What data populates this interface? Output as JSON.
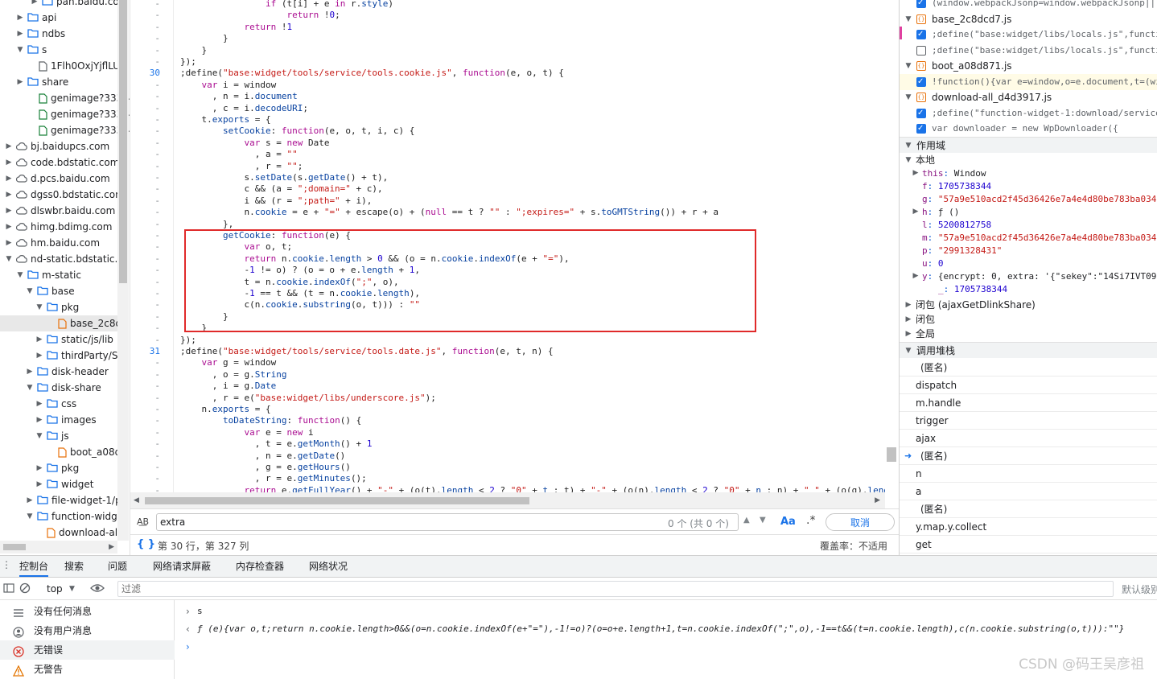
{
  "tree": {
    "rows": [
      {
        "label": "pan.baidu.com",
        "icon": "folder-icon"
      },
      {
        "label": "api",
        "icon": "folder-icon"
      },
      {
        "label": "ndbs",
        "icon": "folder-icon"
      },
      {
        "label": "s",
        "icon": "folder-icon"
      },
      {
        "label": "1Flh0OxjYjflLUY",
        "icon": "file-icon"
      },
      {
        "label": "share",
        "icon": "folder-icon"
      },
      {
        "label": "genimage?333242",
        "icon": "file-icon"
      },
      {
        "label": "genimage?333242",
        "icon": "file-icon"
      },
      {
        "label": "genimage?333242",
        "icon": "file-icon"
      },
      {
        "label": "bj.baidupcs.com",
        "icon": "cloud-icon"
      },
      {
        "label": "code.bdstatic.com",
        "icon": "cloud-icon"
      },
      {
        "label": "d.pcs.baidu.com",
        "icon": "cloud-icon"
      },
      {
        "label": "dgss0.bdstatic.com",
        "icon": "cloud-icon"
      },
      {
        "label": "dlswbr.baidu.com",
        "icon": "cloud-icon"
      },
      {
        "label": "himg.bdimg.com",
        "icon": "cloud-icon"
      },
      {
        "label": "hm.baidu.com",
        "icon": "cloud-icon"
      },
      {
        "label": "nd-static.bdstatic.co",
        "icon": "cloud-icon"
      },
      {
        "label": "m-static",
        "icon": "folder-icon"
      },
      {
        "label": "base",
        "icon": "folder-icon"
      },
      {
        "label": "pkg",
        "icon": "folder-icon"
      },
      {
        "label": "base_2c8dc",
        "icon": "file-icon"
      },
      {
        "label": "static/js/lib",
        "icon": "folder-icon"
      },
      {
        "label": "thirdParty/Sy",
        "icon": "folder-icon"
      },
      {
        "label": "disk-header",
        "icon": "folder-icon"
      },
      {
        "label": "disk-share",
        "icon": "folder-icon"
      },
      {
        "label": "css",
        "icon": "folder-icon"
      },
      {
        "label": "images",
        "icon": "folder-icon"
      },
      {
        "label": "js",
        "icon": "folder-icon"
      },
      {
        "label": "boot_a08d",
        "icon": "file-icon"
      },
      {
        "label": "pkg",
        "icon": "folder-icon"
      },
      {
        "label": "widget",
        "icon": "folder-icon"
      },
      {
        "label": "file-widget-1/p",
        "icon": "folder-icon"
      },
      {
        "label": "function-widge",
        "icon": "folder-icon"
      },
      {
        "label": "download-all",
        "icon": "file-icon"
      }
    ]
  },
  "editor": {
    "line_numbers": [
      "-",
      "-",
      "-",
      "-",
      "-",
      "-",
      "30",
      "-",
      "-",
      "-",
      "-",
      "-",
      "-",
      "-",
      "-",
      "-",
      "-",
      "-",
      "-",
      "-",
      "-",
      "-",
      "-",
      "-",
      "-",
      "-",
      "-",
      "-",
      "-",
      "-",
      "31",
      "-",
      "-",
      "-",
      "-",
      "-",
      "-",
      "-",
      "-",
      "-",
      "-",
      "-",
      "-"
    ],
    "lines": [
      "                if (t[i] + e in r.style)",
      "                    return !0;",
      "            return !1",
      "        }",
      "    }",
      "});",
      ";define(\"base:widget/tools/service/tools.cookie.js\", function(e, o, t) {",
      "    var i = window",
      "      , n = i.document",
      "      , c = i.decodeURI;",
      "    t.exports = {",
      "        setCookie: function(e, o, t, i, c) {",
      "            var s = new Date",
      "              , a = \"\"",
      "              , r = \"\";",
      "            s.setDate(s.getDate() + t),",
      "            c && (a = \";domain=\" + c),",
      "            i && (r = \";path=\" + i),",
      "            n.cookie = e + \"=\" + escape(o) + (null == t ? \"\" : \";expires=\" + s.toGMTString()) + r + a",
      "        },",
      "        getCookie: function(e) {",
      "            var o, t;",
      "            return n.cookie.length > 0 && (o = n.cookie.indexOf(e + \"=\"),",
      "            -1 != o) ? (o = o + e.length + 1,",
      "            t = n.cookie.indexOf(\";\", o),",
      "            -1 == t && (t = n.cookie.length),",
      "            c(n.cookie.substring(o, t))) : \"\"",
      "        }",
      "    }",
      "});",
      ";define(\"base:widget/tools/service/tools.date.js\", function(e, t, n) {",
      "    var g = window",
      "      , o = g.String",
      "      , i = g.Date",
      "      , r = e(\"base:widget/libs/underscore.js\");",
      "    n.exports = {",
      "        toDateString: function() {",
      "            var e = new i",
      "              , t = e.getMonth() + 1",
      "              , n = e.getDate()",
      "              , g = e.getHours()",
      "              , r = e.getMinutes();",
      "            return e.getFullYear() + \"-\" + (o(t).length < 2 ? \"0\" + t : t) + \"-\" + (o(n).length < 2 ? \"0\" + n : n) + \" \" + (o(g).leng"
    ]
  },
  "search": {
    "case_icon": "A͟B",
    "value": "extra",
    "count": "0 个 (共 0 个)",
    "prev": "▲",
    "next": "▼",
    "match_case": "Aa",
    "regex": ".*",
    "cancel": "取消"
  },
  "status": {
    "braces": "{ }",
    "position": "第 30 行，第 327 列",
    "coverage": "覆盖率：不适用"
  },
  "breakpoints": {
    "top_line": "(window.webpackJsonp=window.webpackJsonp||[",
    "groups": [
      {
        "file": "base_2c8dcd7.js",
        "items": [
          {
            "code": ";define(\"base:widget/libs/locals.js\",functi",
            "checked": true
          },
          {
            "code": ";define(\"base:widget/libs/locals.js\",functi",
            "checked": false
          }
        ]
      },
      {
        "file": "boot_a08d871.js",
        "items": [
          {
            "code": "!function(){var e=window,o=e.document,t=(wi",
            "checked": true
          }
        ]
      },
      {
        "file": "download-all_d4d3917.js",
        "items": [
          {
            "code": ";define(\"function-widget-1:download/service",
            "checked": true
          },
          {
            "code": "var downloader = new WpDownloader({",
            "checked": true
          }
        ]
      }
    ]
  },
  "scope": {
    "title": "作用域",
    "local_title": "本地",
    "vars": [
      {
        "name": "this",
        "value": "Window",
        "kind": "obj",
        "expand": true
      },
      {
        "name": "f",
        "value": "1705738344",
        "kind": "num",
        "expand": false
      },
      {
        "name": "g",
        "value": "\"57a9e510acd2f45d36426e7a4e4d80be783ba034",
        "kind": "str",
        "expand": false
      },
      {
        "name": "h",
        "value": "ƒ ()",
        "kind": "obj",
        "expand": true
      },
      {
        "name": "l",
        "value": "5200812758",
        "kind": "num",
        "expand": false
      },
      {
        "name": "m",
        "value": "\"57a9e510acd2f45d36426e7a4e4d80be783ba034",
        "kind": "str",
        "expand": false
      },
      {
        "name": "p",
        "value": "\"2991328431\"",
        "kind": "str",
        "expand": false
      },
      {
        "name": "u",
        "value": "0",
        "kind": "num",
        "expand": false
      },
      {
        "name": "y",
        "value": "{encrypt: 0, extra: '{\"sekey\":\"14Si7IVT09",
        "kind": "obj",
        "expand": true
      },
      {
        "name": "_",
        "value": "1705738344",
        "kind": "num",
        "expand": false
      }
    ],
    "closures": [
      "闭包 (ajaxGetDlinkShare)",
      "闭包",
      "全局"
    ]
  },
  "callstack": {
    "title": "调用堆栈",
    "frames": [
      "(匿名)",
      "dispatch",
      "m.handle",
      "trigger",
      "ajax",
      "(匿名)",
      "n",
      "a",
      "(匿名)",
      "y.map.y.collect",
      "get"
    ]
  },
  "drawer": {
    "menu_icon": "⋮",
    "tabs": [
      "控制台",
      "搜索",
      "问题",
      "网络请求屏蔽",
      "内存检查器",
      "网络状况"
    ],
    "context": "top",
    "filter_placeholder": "过滤",
    "default_levels": "默认级别",
    "side": [
      "没有任何消息",
      "没有用户消息",
      "无错误",
      "无警告"
    ],
    "input_echo": "s",
    "output": "ƒ (e){var o,t;return n.cookie.length>0&&(o=n.cookie.indexOf(e+\"=\"),-1!=o)?(o=o+e.length+1,t=n.cookie.indexOf(\";\",o),-1==t&&(t=n.cookie.length),c(n.cookie.substring(o,t))):\"\"}"
  },
  "watermark": "CSDN @码王吴彦祖",
  "colors": {
    "accent": "#1a73e8",
    "highlight_box": "#e02a2a",
    "folder": "#1a73e8",
    "file": "#e8710a"
  }
}
